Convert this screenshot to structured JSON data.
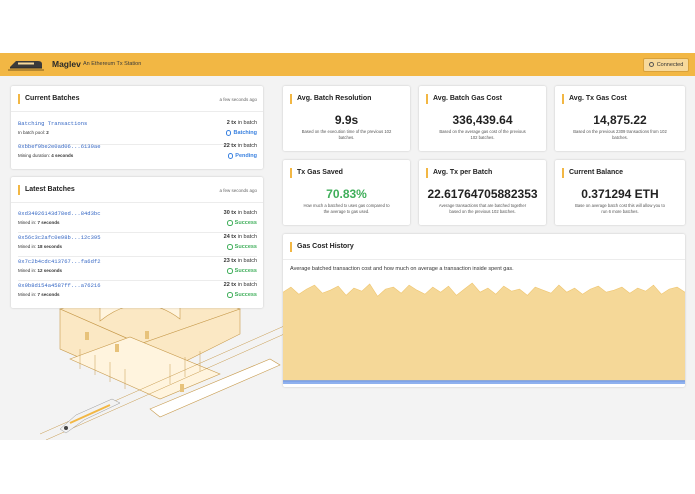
{
  "app": {
    "name": "Maglev",
    "tagline": "An Ethereum Tx Station",
    "connection_status": "Connected"
  },
  "current_batches": {
    "title": "Current Batches",
    "updated": "a few seconds ago",
    "rows": [
      {
        "hash": "Batching Transactions",
        "sub_label": "In batch pool:",
        "sub_value": "2",
        "tx_count": "2 tx",
        "tx_suffix": "in batch",
        "status": "Batching",
        "status_kind": "blue"
      },
      {
        "hash": "0xbbef9be2e0ad06...6130ae",
        "sub_label": "Mining duration:",
        "sub_value": "4 seconds",
        "tx_count": "22 tx",
        "tx_suffix": "in batch",
        "status": "Pending",
        "status_kind": "blue"
      }
    ]
  },
  "latest_batches": {
    "title": "Latest Batches",
    "updated": "a few seconds ago",
    "rows": [
      {
        "hash": "0xd34926143d78ed...84d3bc",
        "sub_label": "Mined in:",
        "sub_value": "7 seconds",
        "tx_count": "30 tx",
        "tx_suffix": "in batch",
        "status": "Success",
        "status_kind": "green"
      },
      {
        "hash": "0x56c3c2afc0e98b...12c395",
        "sub_label": "Mined in:",
        "sub_value": "18 seconds",
        "tx_count": "24 tx",
        "tx_suffix": "in batch",
        "status": "Success",
        "status_kind": "green"
      },
      {
        "hash": "0x7c2b4cdc413767...fa6df2",
        "sub_label": "Mined in:",
        "sub_value": "12 seconds",
        "tx_count": "23 tx",
        "tx_suffix": "in batch",
        "status": "Success",
        "status_kind": "green"
      },
      {
        "hash": "0x9b8d154a4587ff...a76216",
        "sub_label": "Mined in:",
        "sub_value": "7 seconds",
        "tx_count": "22 tx",
        "tx_suffix": "in batch",
        "status": "Success",
        "status_kind": "green"
      }
    ]
  },
  "stats": [
    {
      "title": "Avg. Batch Resolution",
      "value": "9.9s",
      "desc": "Based on the execution time of the previous 102 batches."
    },
    {
      "title": "Avg. Batch Gas Cost",
      "value": "336,439.64",
      "desc": "Based on the average gas cost of the previous 102 batches."
    },
    {
      "title": "Avg. Tx Gas Cost",
      "value": "14,875.22",
      "desc": "Based on the previous 2309 transactions from 102 batches."
    },
    {
      "title": "Tx Gas Saved",
      "value": "70.83%",
      "desc": "How much a batched tx uses gas compared to the average tx gas used.",
      "highlight": "#3fae5a"
    },
    {
      "title": "Avg. Tx per Batch",
      "value": "22.61764705882353",
      "desc": "Average transactions that are batched together based on the previous 102 batches."
    },
    {
      "title": "Current Balance",
      "value": "0.371294 ETH",
      "desc": "Base on average batch cost this will allow you to run 6 more batches."
    }
  ],
  "gas_history": {
    "title": "Gas Cost History",
    "description": "Average batched transaction cost and how much on average a transaction inside spent gas."
  },
  "chart_data": {
    "type": "area",
    "title": "Gas Cost History",
    "series": [
      {
        "values": [
          0.9,
          0.95,
          0.88,
          0.93,
          0.97,
          0.89,
          0.92,
          0.96,
          0.87,
          0.94,
          0.91,
          0.98,
          0.86,
          0.93,
          0.95,
          0.89,
          0.97,
          0.92,
          0.88,
          0.95,
          0.9,
          0.96,
          0.87,
          0.93,
          0.99,
          0.9,
          0.94,
          0.88,
          0.96,
          0.91,
          0.93,
          0.87,
          0.95,
          0.92,
          0.89,
          0.97,
          0.9,
          0.94,
          0.88,
          0.93,
          0.96,
          0.9,
          0.92,
          0.95,
          0.89,
          0.94,
          0.91,
          0.97,
          0.88,
          0.93,
          0.95,
          0.9
        ]
      },
      {
        "values": [
          0.03,
          0.03,
          0.03,
          0.03,
          0.03,
          0.03,
          0.03,
          0.03,
          0.03,
          0.03,
          0.03,
          0.03,
          0.03,
          0.03,
          0.03,
          0.03,
          0.03,
          0.03,
          0.03,
          0.03,
          0.03,
          0.03,
          0.03,
          0.03,
          0.03,
          0.03,
          0.03,
          0.03,
          0.03,
          0.03,
          0.03,
          0.03,
          0.03,
          0.03,
          0.03,
          0.03,
          0.03,
          0.03,
          0.03,
          0.03,
          0.03,
          0.03,
          0.03,
          0.03,
          0.03,
          0.03,
          0.03,
          0.03,
          0.03,
          0.03,
          0.03,
          0.03
        ]
      }
    ],
    "colors": [
      "#f5d898",
      "#8fb1ee"
    ],
    "grid": false
  }
}
